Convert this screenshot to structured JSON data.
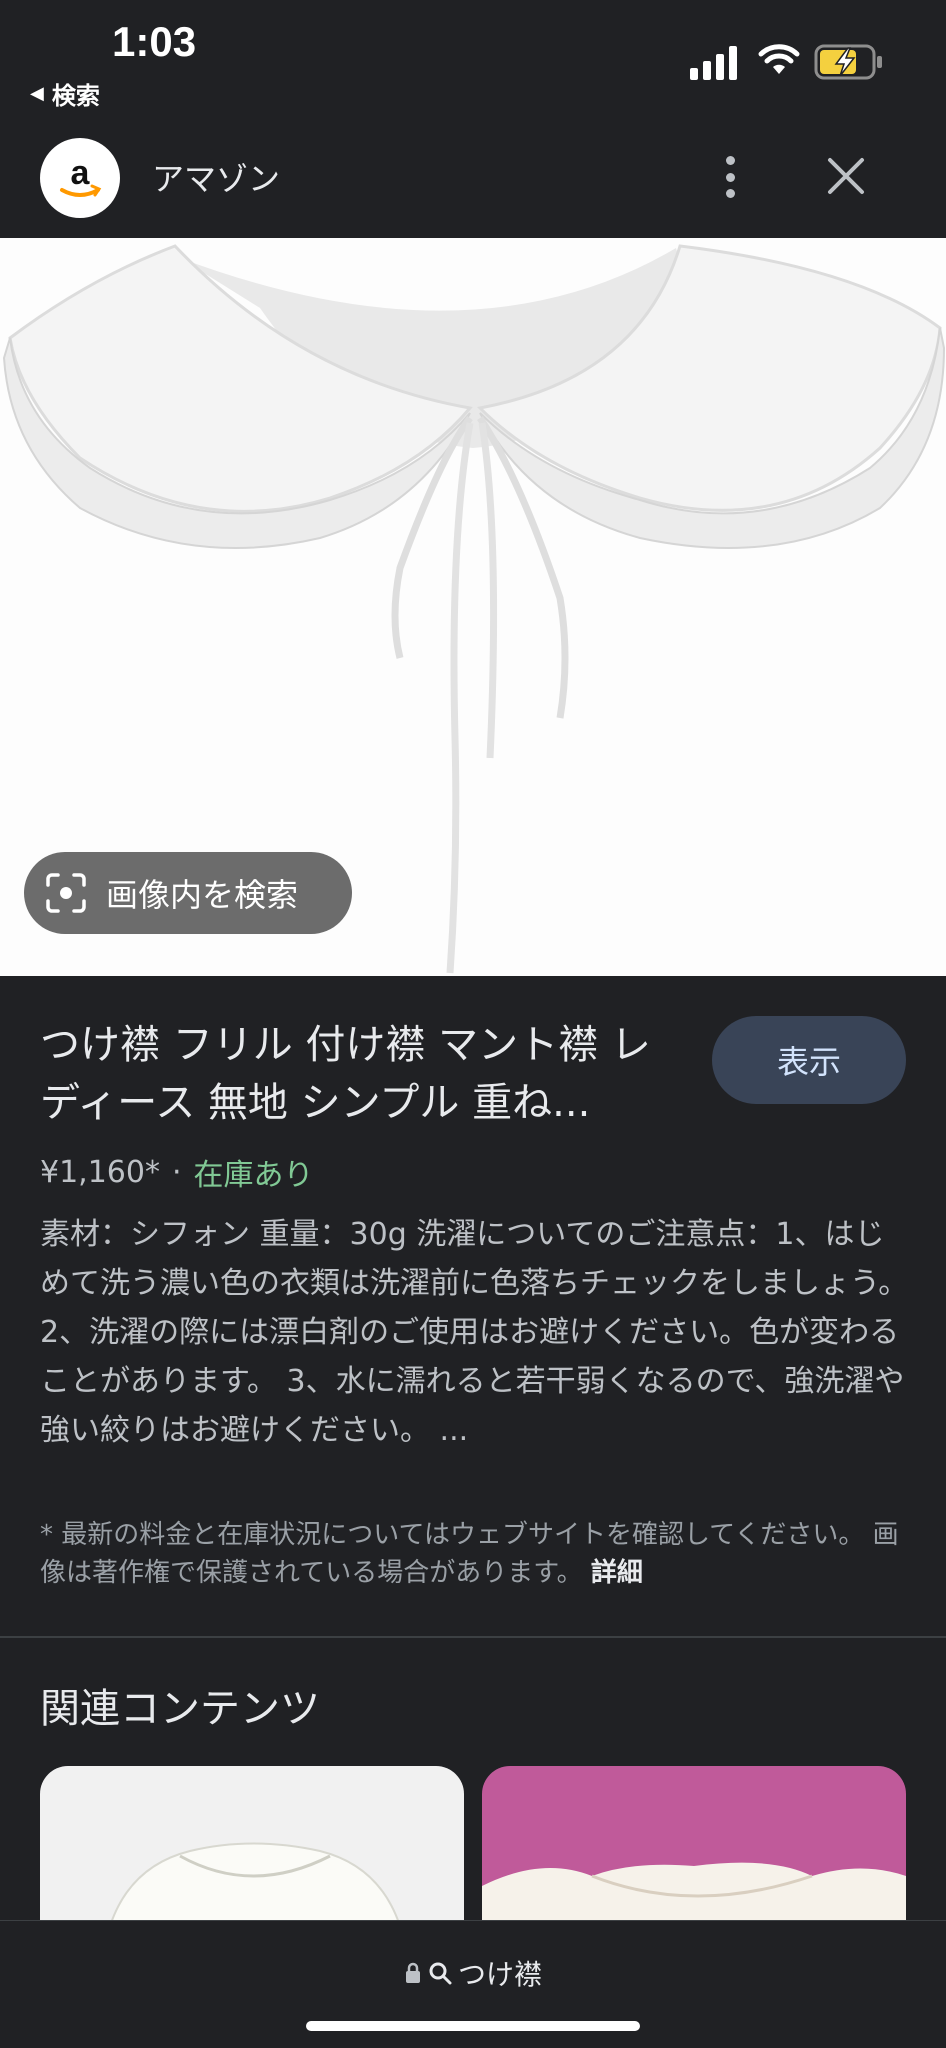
{
  "status_bar": {
    "time": "1:03",
    "back_label": "検索"
  },
  "source": {
    "logo_letter": "a",
    "name": "アマゾン"
  },
  "image": {
    "lens_label": "画像内を検索"
  },
  "product": {
    "title": "つけ襟 フリル 付け襟 マント襟 レディース 無地 シンプル 重ね...",
    "view_label": "表示",
    "price": "¥1,160*",
    "separator": "·",
    "stock": "在庫あり",
    "description": "素材：シフォン 重量：30g 洗濯についてのご注意点：1、はじめて洗う濃い色の衣類は洗濯前に色落ちチェックをしましょう。 2、洗濯の際には漂白剤のご使用はお避けください。色が変わることがあります。 3、水に濡れると若干弱くなるので、強洗濯や強い絞りはお避けください。 ...",
    "disclaimer": "* 最新の料金と在庫状況についてはウェブサイトを確認してください。 画像は著作権で保護されている場合があります。",
    "details_label": "詳細"
  },
  "related": {
    "title": "関連コンテンツ"
  },
  "bottom_bar": {
    "url": "つけ襟"
  },
  "colors": {
    "background": "#202124",
    "stock_green": "#81c995",
    "button_bg": "#394457",
    "battery_yellow": "#f4d03f"
  }
}
